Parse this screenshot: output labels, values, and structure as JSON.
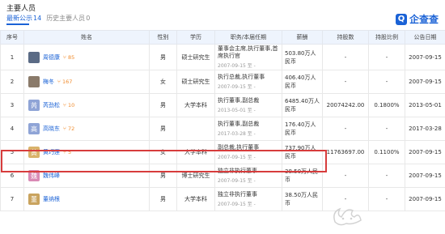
{
  "section_title": "主要人员",
  "tabs": [
    {
      "label": "最新公示",
      "count": "14"
    },
    {
      "label": "历史主要人员",
      "count": "0"
    }
  ],
  "logo": {
    "mark": "Q",
    "text": "企查查"
  },
  "headers": [
    "序号",
    "姓名",
    "性别",
    "学历",
    "职务/本届任期",
    "薪酬",
    "持股数",
    "持股比例",
    "公告日期"
  ],
  "rows": [
    {
      "no": "1",
      "avatar_text": "",
      "avatar_color": "#5b6b85",
      "name": "周德康",
      "badge": "85",
      "gender": "男",
      "edu": "硕士研究生",
      "position": "董事会主席,执行董事,首席执行官",
      "term": "2007-09-15 至 -",
      "salary": "503.80万人民币",
      "shares": "-",
      "ratio": "-",
      "date": "2007-09-15"
    },
    {
      "no": "2",
      "avatar_text": "",
      "avatar_color": "#8a7a6a",
      "name": "梅冬",
      "badge": "167",
      "gender": "女",
      "edu": "硕士研究生",
      "position": "执行总裁,执行董事",
      "term": "2007-09-15 至 -",
      "salary": "406.40万人民币",
      "shares": "-",
      "ratio": "-",
      "date": "2007-09-15"
    },
    {
      "no": "3",
      "avatar_text": "芮",
      "avatar_color": "#8fa4d6",
      "name": "芮劲松",
      "badge": "10",
      "gender": "男",
      "edu": "大学本科",
      "position": "执行董事,副总裁",
      "term": "2013-05-01 至 -",
      "salary": "6485.40万人民币",
      "shares": "20074242.00",
      "ratio": "0.1800%",
      "date": "2013-05-01"
    },
    {
      "no": "4",
      "avatar_text": "高",
      "avatar_color": "#8fa4d6",
      "name": "高晓东",
      "badge": "72",
      "gender": "男",
      "edu": "",
      "position": "执行董事,副总裁",
      "term": "2017-03-28 至 -",
      "salary": "176.40万人民币",
      "shares": "-",
      "ratio": "-",
      "date": "2017-03-28"
    },
    {
      "no": "5",
      "avatar_text": "黄",
      "avatar_color": "#d9b26a",
      "name": "黄巧莲",
      "badge": "5",
      "gender": "女",
      "edu": "大学本科",
      "position": "副总裁,执行董事",
      "term": "2007-09-15 至 -",
      "salary": "737.90万人民币",
      "shares": "11763697.00",
      "ratio": "0.1100%",
      "date": "2007-09-15"
    },
    {
      "no": "6",
      "avatar_text": "魏",
      "avatar_color": "#d98ab5",
      "name": "魏伟峰",
      "badge": "",
      "gender": "男",
      "edu": "博士研究生",
      "position": "独立非执行董事",
      "term": "2007-09-15 至 -",
      "salary": "38.50万人民币",
      "shares": "-",
      "ratio": "-",
      "date": "2007-09-15"
    },
    {
      "no": "7",
      "avatar_text": "董",
      "avatar_color": "#c9a35e",
      "name": "董纳根",
      "badge": "",
      "gender": "男",
      "edu": "大学本科",
      "position": "独立非执行董事",
      "term": "2007-09-15 至 -",
      "salary": "38.50万人民币",
      "shares": "-",
      "ratio": "-",
      "date": "2007-09-15"
    }
  ]
}
